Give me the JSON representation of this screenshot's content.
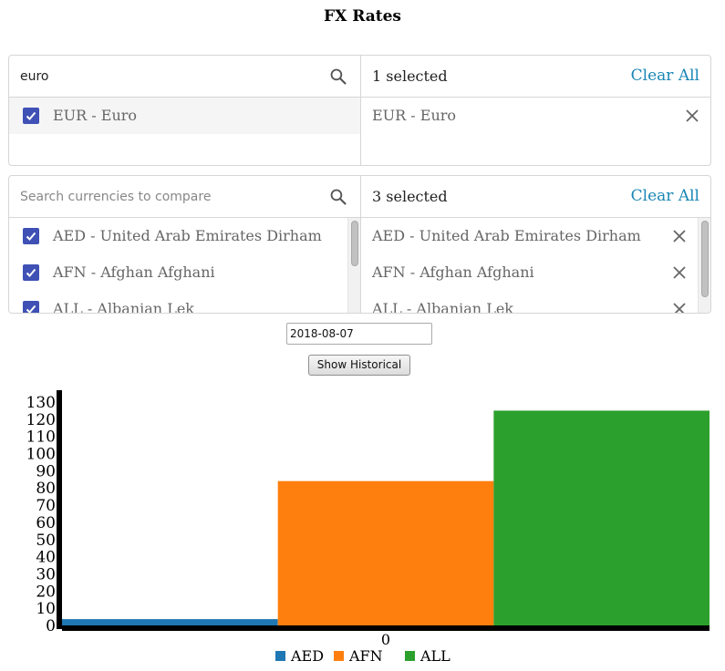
{
  "page": {
    "title": "FX Rates"
  },
  "base_panel": {
    "search": {
      "value": "euro",
      "placeholder": ""
    },
    "results": [
      {
        "label": "EUR - Euro",
        "checked": true
      }
    ],
    "selected_count": "1 selected",
    "clear_label": "Clear All",
    "selected": [
      {
        "label": "EUR - Euro"
      }
    ]
  },
  "compare_panel": {
    "search": {
      "value": "",
      "placeholder": "Search currencies to compare"
    },
    "results": [
      {
        "label": "AED - United Arab Emirates Dirham",
        "checked": true
      },
      {
        "label": "AFN - Afghan Afghani",
        "checked": true
      },
      {
        "label": "ALL - Albanian Lek",
        "checked": true
      }
    ],
    "selected_count": "3 selected",
    "clear_label": "Clear All",
    "selected": [
      {
        "label": "AED - United Arab Emirates Dirham"
      },
      {
        "label": "AFN - Afghan Afghani"
      },
      {
        "label": "ALL - Albanian Lek"
      }
    ]
  },
  "date_input": {
    "value": "2018-08-07"
  },
  "historical_button": {
    "label": "Show Historical"
  },
  "colors": {
    "accent": "#1a87b5",
    "checkbox": "#3f51b5"
  },
  "icons": {
    "search": "search-icon",
    "remove": "close-icon",
    "check": "check-icon"
  },
  "chart_data": {
    "type": "bar",
    "categories": [
      "0"
    ],
    "series": [
      {
        "name": "AED",
        "values": [
          3.67
        ],
        "color": "#1f77b4"
      },
      {
        "name": "AFN",
        "values": [
          84.0
        ],
        "color": "#ff7f0e"
      },
      {
        "name": "ALL",
        "values": [
          125.0
        ],
        "color": "#2ca02c"
      }
    ],
    "ylim": [
      0,
      130
    ],
    "yticks": [
      "0",
      "10",
      "20",
      "30",
      "40",
      "50",
      "60",
      "70",
      "80",
      "90",
      "100",
      "110",
      "120",
      "130"
    ],
    "xticks": [
      "0"
    ],
    "legend": "bottom-center",
    "grid": false
  }
}
